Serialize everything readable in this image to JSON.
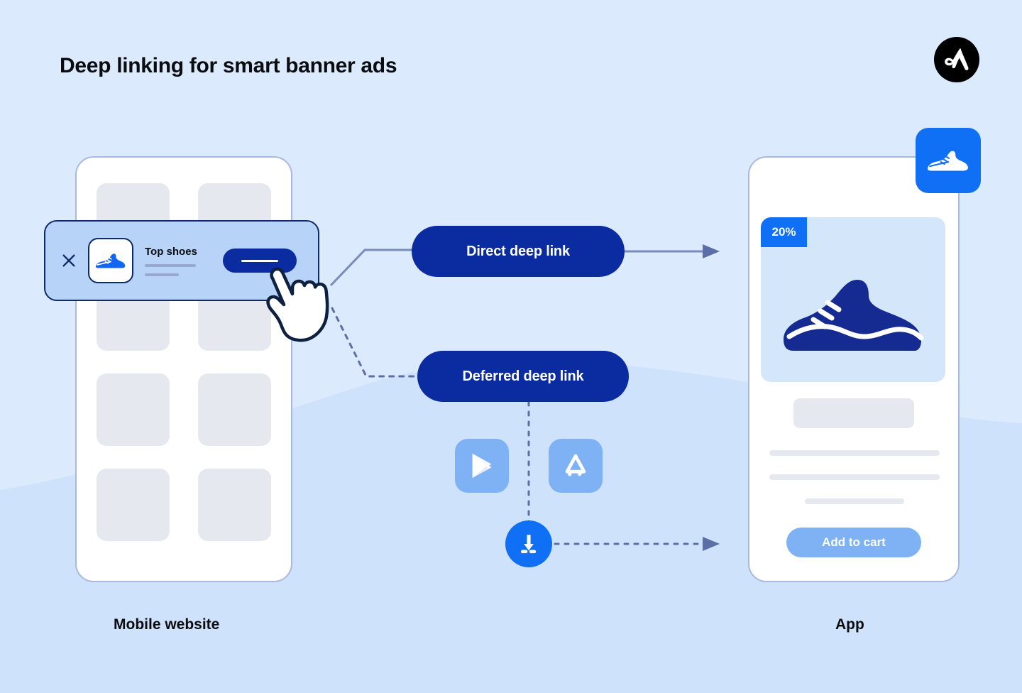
{
  "header": {
    "title": "Deep linking for smart banner ads",
    "logo_icon": "appsflyer-logo-icon"
  },
  "colors": {
    "background": "#dbeafc",
    "wave": "#cfe2fb",
    "deep_navy": "#0b2ba0",
    "bright_blue": "#1070f5",
    "light_blue": "#7eb2f5",
    "banner_bg": "#b7d4f8",
    "outline_navy": "#0d2a6b",
    "connector_gray": "#7b8bbd",
    "placeholder_gray": "#e6e8f0"
  },
  "mobile_website": {
    "caption": "Mobile website",
    "grid_tiles": 8,
    "smart_banner": {
      "close_icon": "close-x-icon",
      "app_icon": "shoe-app-icon",
      "title": "Top shoes",
      "subtitle_lines": 2,
      "cta_label": "",
      "cta_icon": "install-bar-icon"
    },
    "cursor_icon": "pointing-hand-cursor-icon"
  },
  "flow": {
    "direct_link_label": "Direct deep link",
    "deferred_link_label": "Deferred deep link",
    "store_icons": [
      {
        "name": "google-play-icon",
        "label": "Google Play"
      },
      {
        "name": "app-store-icon",
        "label": "App Store"
      }
    ],
    "download_icon": "download-install-icon"
  },
  "app": {
    "caption": "App",
    "app_icon": "shoe-app-icon",
    "product": {
      "discount_badge": "20%",
      "image_icon": "sneaker-product-icon"
    },
    "placeholder_block": true,
    "placeholder_lines": 3,
    "add_to_cart_label": "Add to cart"
  }
}
